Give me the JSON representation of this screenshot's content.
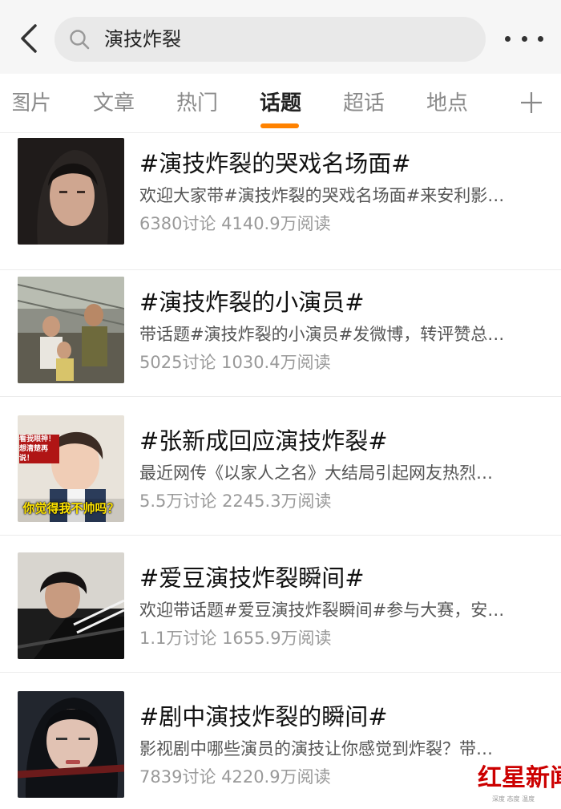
{
  "search": {
    "query": "演技炸裂"
  },
  "tabs": [
    "图片",
    "文章",
    "热门",
    "话题",
    "超话",
    "地点"
  ],
  "active_tab": "话题",
  "topics": [
    {
      "title": "#演技炸裂的哭戏名场面#",
      "desc": "欢迎大家带#演技炸裂的哭戏名场面#来安利影…",
      "stats": "6380讨论 4140.9万阅读"
    },
    {
      "title": "#演技炸裂的小演员#",
      "desc": "带话题#演技炸裂的小演员#发微博，转评赞总…",
      "stats": "5025讨论 1030.4万阅读"
    },
    {
      "title": "#张新成回应演技炸裂#",
      "desc": "最近网传《以家人之名》大结局引起网友热烈…",
      "stats": "5.5万讨论 2245.3万阅读",
      "thumb_caption_top": "看我眼神！想清楚再说！",
      "thumb_caption_bottom": "你觉得我不帅吗？"
    },
    {
      "title": "#爱豆演技炸裂瞬间#",
      "desc": "欢迎带话题#爱豆演技炸裂瞬间#参与大赛，安…",
      "stats": "1.1万讨论 1655.9万阅读"
    },
    {
      "title": "#剧中演技炸裂的瞬间#",
      "desc": "影视剧中哪些演员的演技让你感觉到炸裂？带…",
      "stats": "7839讨论 4220.9万阅读"
    }
  ],
  "watermark": {
    "logo": "红星新闻",
    "tagline": "深度 态度 温度"
  },
  "icons": {
    "back": "chevron-left-icon",
    "search": "search-icon",
    "more": "more-dots-icon",
    "plus": "plus-icon"
  },
  "colors": {
    "accent": "#ff8200",
    "watermark": "#cc0000"
  }
}
